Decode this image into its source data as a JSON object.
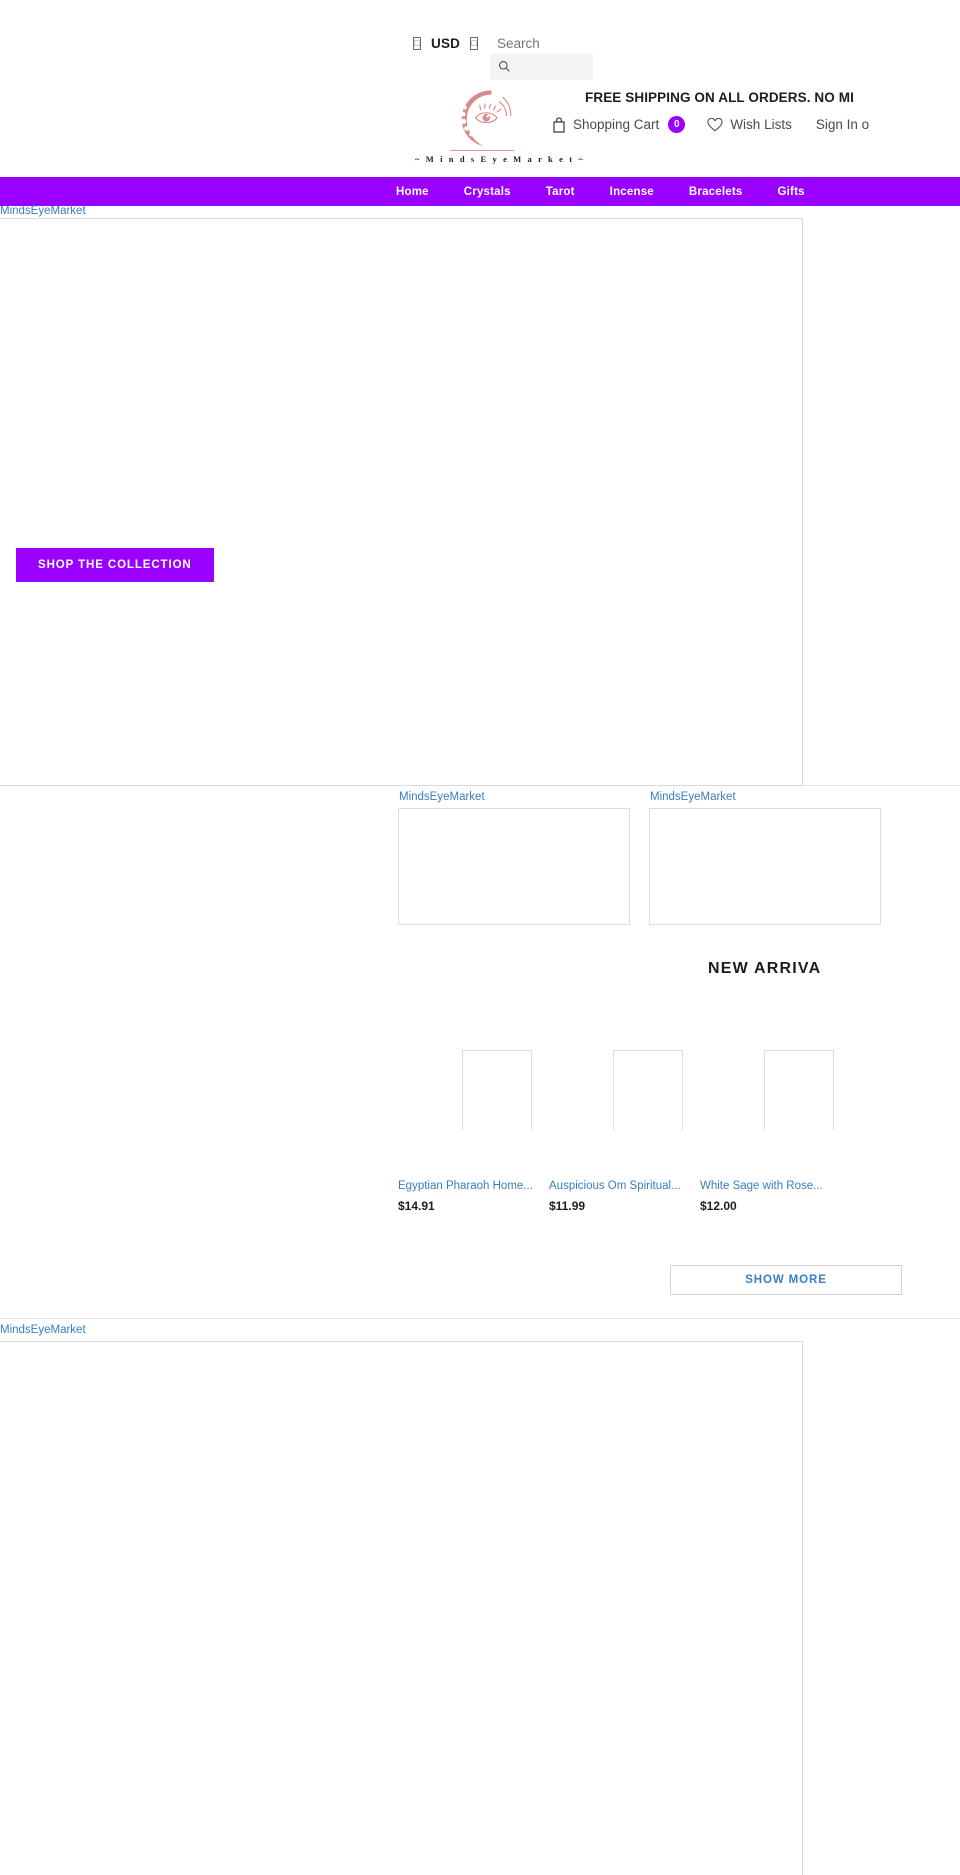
{
  "topbar": {
    "currency": {
      "left_glyph": "□",
      "code": "USD",
      "right_glyph": "□"
    },
    "search": {
      "label": "Search",
      "placeholder": "",
      "value": ""
    }
  },
  "logo": {
    "wordmark": "~ M i n d s E y e M a r k e t ~",
    "icon_name": "moon-eye-logo",
    "color": "#d98b8b"
  },
  "header": {
    "promo_text": "FREE SHIPPING ON ALL ORDERS. NO MI",
    "cart_label": "Shopping Cart",
    "cart_count": "0",
    "cart_badge_color": "#9900ff",
    "wishlist_label": "Wish Lists",
    "account_label": "Sign In o"
  },
  "nav": {
    "accent_color": "#9900ff",
    "items": [
      {
        "label": "Home"
      },
      {
        "label": "Crystals"
      },
      {
        "label": "Tarot"
      },
      {
        "label": "Incense"
      },
      {
        "label": "Bracelets"
      },
      {
        "label": "Gifts"
      }
    ]
  },
  "hero": {
    "alt_text": "MindsEyeMarket",
    "cta_label": "SHOP THE COLLECTION",
    "cta_color": "#9900ff"
  },
  "tiles": [
    {
      "alt_text": "MindsEyeMarket"
    },
    {
      "alt_text": "MindsEyeMarket"
    }
  ],
  "arrivals": {
    "title": "NEW ARRIVA",
    "show_more_label": "SHOW MORE",
    "products": [
      {
        "title": "Egyptian Pharaoh Home...",
        "price": "$14.91"
      },
      {
        "title": "Auspicious Om Spiritual...",
        "price": "$11.99"
      },
      {
        "title": "White Sage with Rose...",
        "price": "$12.00"
      }
    ]
  },
  "bottom_banner": {
    "alt_text": "MindsEyeMarket"
  }
}
